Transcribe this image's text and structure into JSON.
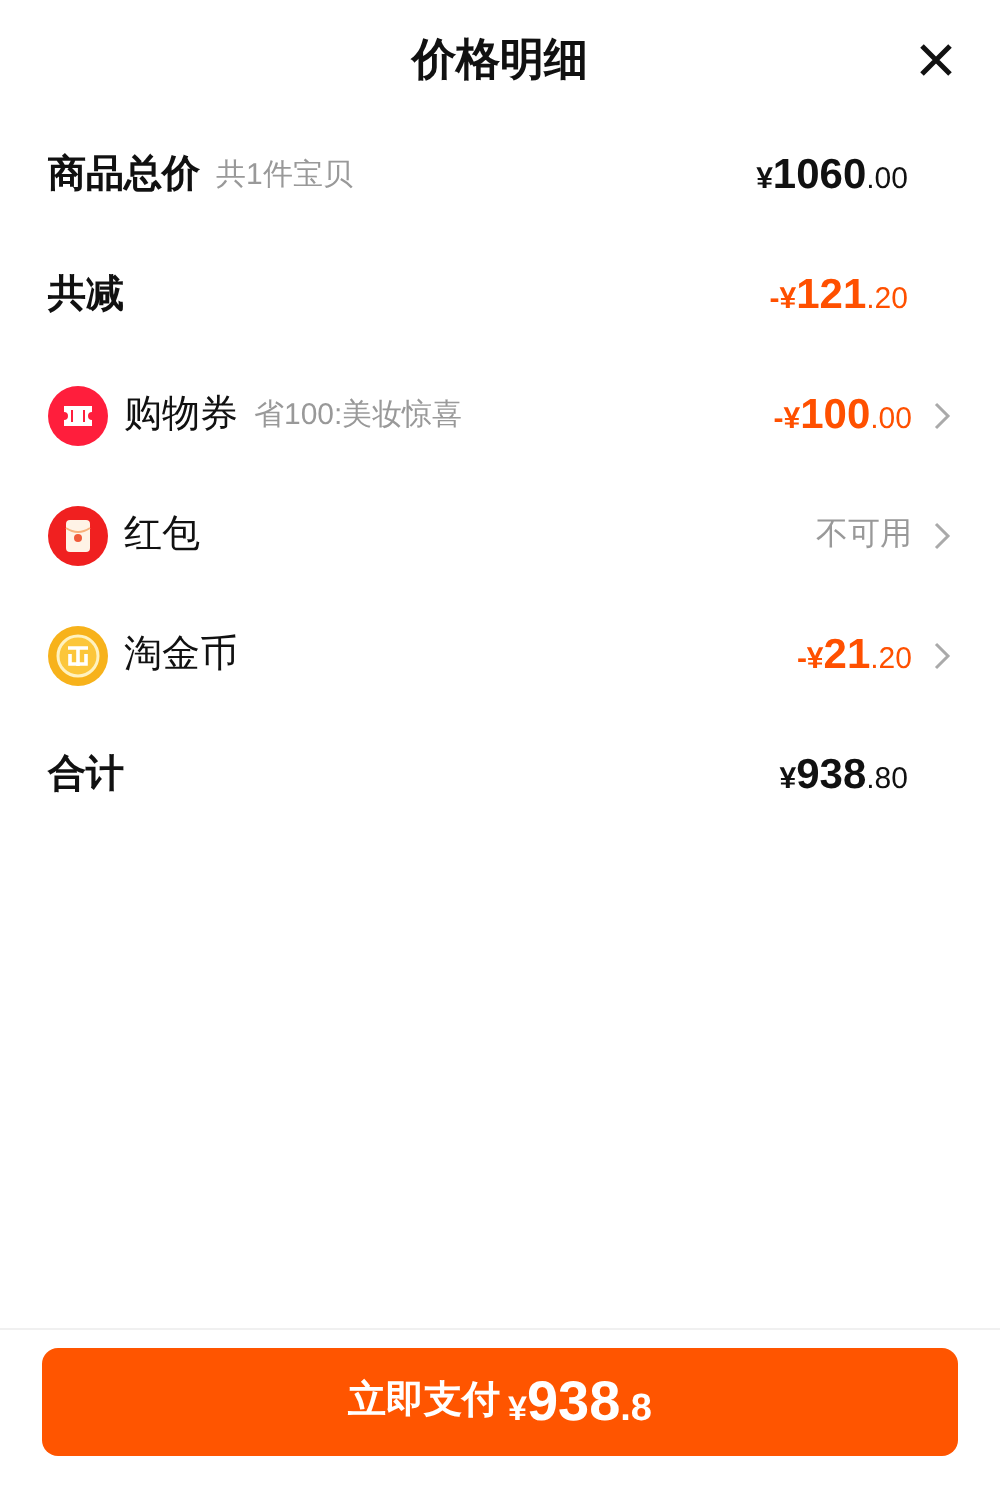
{
  "title": "价格明细",
  "rows": [
    {
      "kind": "heading",
      "label": "商品总价",
      "note": "共1件宝贝",
      "amount": "¥1060.00",
      "discount": false
    },
    {
      "kind": "heading",
      "label": "共减",
      "amount": "-¥121.20",
      "discount": true
    },
    {
      "kind": "coupon",
      "label": "购物券",
      "note": "省100:美妆惊喜",
      "amount": "-¥100.00",
      "discount": true
    },
    {
      "kind": "red_packet",
      "label": "红包",
      "status": "不可用"
    },
    {
      "kind": "coin",
      "label": "淘金币",
      "amount": "-¥21.20",
      "discount": true
    },
    {
      "kind": "heading",
      "label": "合计",
      "amount": "¥938.80",
      "discount": false
    }
  ],
  "pay_button": {
    "label": "立即支付",
    "amount": "¥938.8"
  }
}
